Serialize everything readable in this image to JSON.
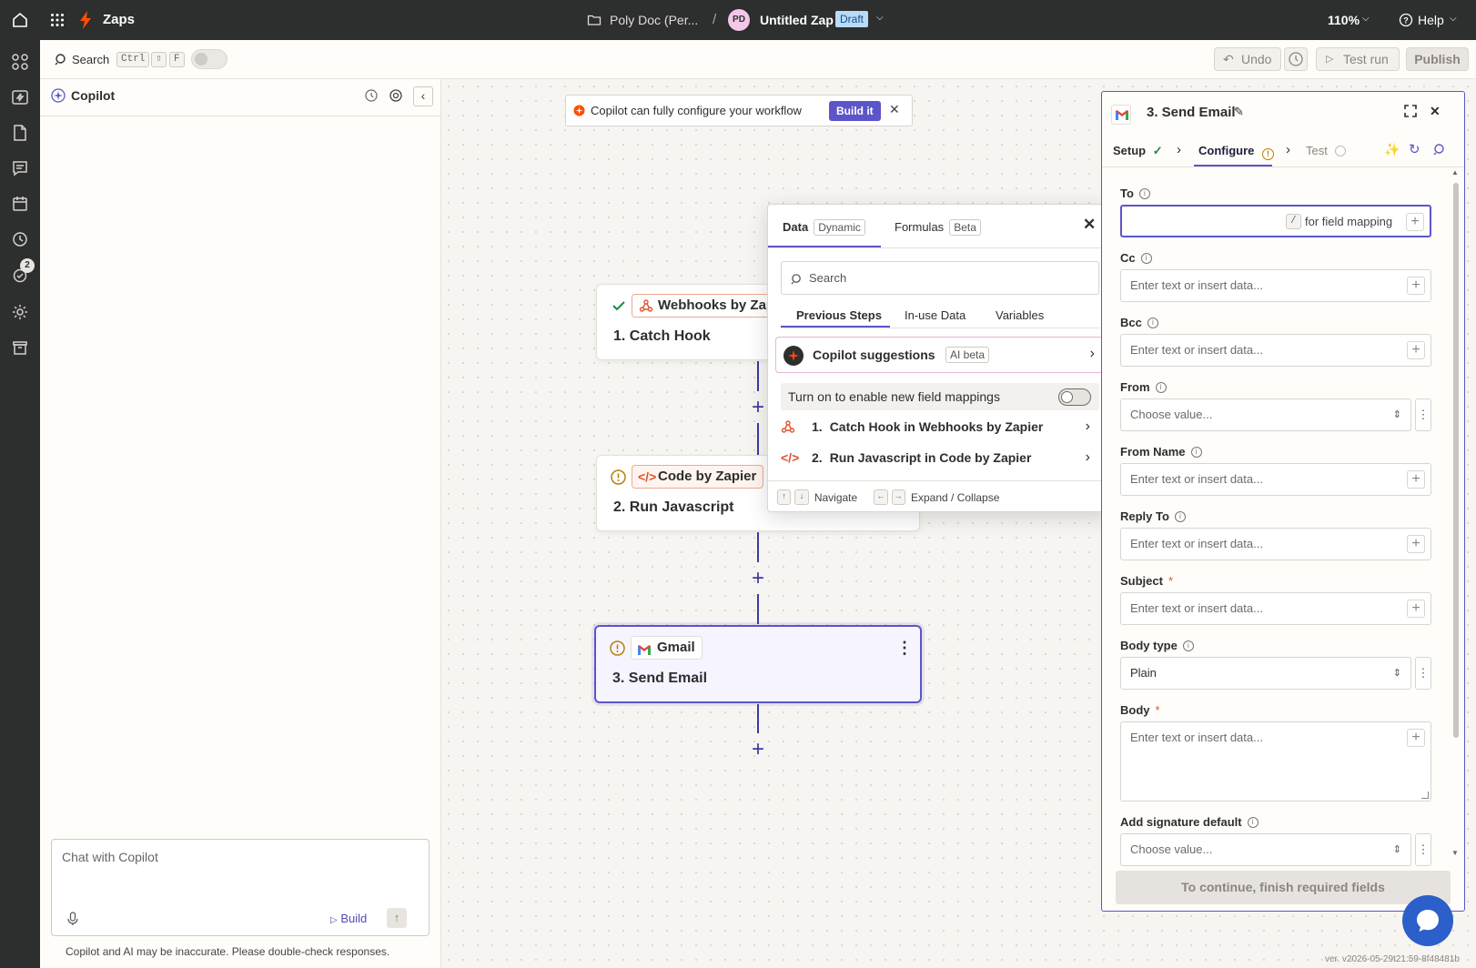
{
  "topbar": {
    "app_title": "Zaps",
    "folder_name": "Poly Doc (Per...",
    "separator": "/",
    "avatar_initials": "PD",
    "zap_name": "Untitled Zap",
    "status_badge": "Draft",
    "zoom": "110%",
    "help_label": "Help"
  },
  "leftnav": {
    "notification_count": "2"
  },
  "toolbar": {
    "search_label": "Search",
    "shortcut_ctrl": "Ctrl",
    "shortcut_shift": "⇧",
    "shortcut_f": "F",
    "undo_label": "Undo",
    "test_run_label": "Test run",
    "publish_label": "Publish"
  },
  "copilot": {
    "title": "Copilot",
    "chat_placeholder": "Chat with Copilot",
    "build_label": "Build",
    "disclaimer": "Copilot and AI may be inaccurate. Please double-check responses."
  },
  "banner": {
    "text": "Copilot can fully configure your workflow",
    "button_label": "Build it"
  },
  "steps": [
    {
      "app": "Webhooks by Zap",
      "title": "1. Catch Hook"
    },
    {
      "app": "Code by Zapier",
      "title": "2. Run Javascript"
    },
    {
      "app": "Gmail",
      "title": "3. Send Email"
    }
  ],
  "data_popup": {
    "tab_data": "Data",
    "tab_data_tag": "Dynamic",
    "tab_formulas": "Formulas",
    "tab_formulas_tag": "Beta",
    "search_placeholder": "Search",
    "subtabs": [
      "Previous Steps",
      "In-use Data",
      "Variables"
    ],
    "copilot_suggestions": "Copilot suggestions",
    "ai_tag": "AI beta",
    "toggle_label": "Turn on to enable new field mappings",
    "step_rows": [
      {
        "num": "1.",
        "label": "Catch Hook in Webhooks by Zapier"
      },
      {
        "num": "2.",
        "label": "Run Javascript in Code by Zapier"
      }
    ],
    "footer_up": "↑",
    "footer_down": "↓",
    "footer_navigate": "Navigate",
    "footer_left": "←",
    "footer_right": "→",
    "footer_expand": "Expand / Collapse"
  },
  "panel": {
    "title": "3. Send Email",
    "tab_setup": "Setup",
    "tab_configure": "Configure",
    "tab_test": "Test",
    "fields": {
      "to_label": "To",
      "to_hint_key": "/",
      "to_hint": "for field mapping",
      "cc_label": "Cc",
      "bcc_label": "Bcc",
      "from_label": "From",
      "from_name_label": "From Name",
      "reply_to_label": "Reply To",
      "subject_label": "Subject",
      "body_type_label": "Body type",
      "body_type_value": "Plain",
      "body_label": "Body",
      "signature_label": "Add signature default",
      "required_mark": "*",
      "input_placeholder": "Enter text or insert data...",
      "select_placeholder": "Choose value..."
    },
    "continue_button": "To continue, finish required fields"
  },
  "version": "ver. v2026-05-29t21:59-8f48481b",
  "colors": {
    "accent": "#3d38a3",
    "brand": "#ff4f00",
    "dark": "#2d2e2e",
    "warning": "#b5800e",
    "success": "#1a8a4a"
  }
}
